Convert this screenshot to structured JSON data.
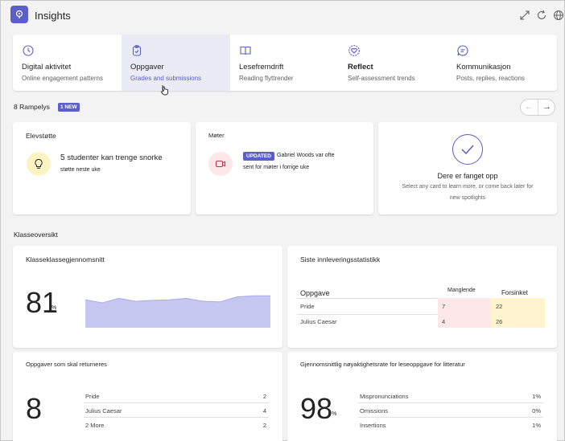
{
  "app": {
    "title": "Insights"
  },
  "tabs": [
    {
      "label": "Digital aktivitet",
      "sub": "Online engagement patterns"
    },
    {
      "label": "Oppgaver",
      "sub": "Grades and submissions"
    },
    {
      "label": "Lesefremdrift",
      "sub": "Reading flyttrender"
    },
    {
      "label": "Reflect",
      "sub": "Self-assessment trends"
    },
    {
      "label": "Kommunikasjon",
      "sub": "Posts, replies, reactions"
    }
  ],
  "spotlights": {
    "heading": "8 Rampelys",
    "badge": "1 NEW",
    "cards": {
      "support": {
        "title": "Elevstøtte",
        "count": "5",
        "text1": "studenter kan trenge snorke",
        "text2": "støtte neste uke"
      },
      "meetings": {
        "title": "Møter",
        "badge": "UPDATED",
        "text1": "Gabriel Woods var ofte",
        "text2": "sent for møter i forrige uke"
      },
      "caught_up": {
        "title": "Dere er fanget opp",
        "text1": "Select any card to learn more, or come back later for",
        "text2": "new spotlights"
      }
    }
  },
  "overview": {
    "heading": "Klasseoversikt",
    "class_avg": {
      "title": "Klasseklassegjennomsnitt",
      "value": "81",
      "unit": "%",
      "trend": [
        0.56,
        0.5,
        0.59,
        0.53,
        0.55,
        0.56,
        0.59,
        0.53,
        0.52,
        0.62,
        0.64,
        0.64
      ]
    },
    "submissions": {
      "title": "Siste innleveringsstatistikk",
      "col_task": "Oppgave",
      "col_missing": "Manglende",
      "col_late": "Forsinket",
      "rows": [
        {
          "name": "Pride",
          "missing": "7",
          "late": "22"
        },
        {
          "name": "Julius Caesar",
          "missing": "4",
          "late": "26"
        }
      ],
      "missing_color": "#fde7e9",
      "late_color": "#fff4ce"
    },
    "to_return": {
      "title": "Oppgaver som skal returneres",
      "value": "8",
      "rows": [
        {
          "name": "Pride",
          "value": "2"
        },
        {
          "name": "Julius Caesar",
          "value": "4"
        },
        {
          "name": "2 More",
          "value": "2"
        }
      ]
    },
    "accuracy": {
      "title": "Gjennomsnittlig nøyaktighetsrate for leseoppgave for litteratur",
      "value": "98",
      "unit": "%",
      "rows": [
        {
          "name": "Mispronunciations",
          "value": "1%"
        },
        {
          "name": "Omissions",
          "value": "0%"
        },
        {
          "name": "Insertions",
          "value": "1%"
        }
      ]
    }
  },
  "colors": {
    "brand": "#5b5fc7",
    "tab_active_bg": "#ebebf6",
    "chart_fill": "#c5c7f0",
    "chart_line": "#a7aaeb"
  }
}
